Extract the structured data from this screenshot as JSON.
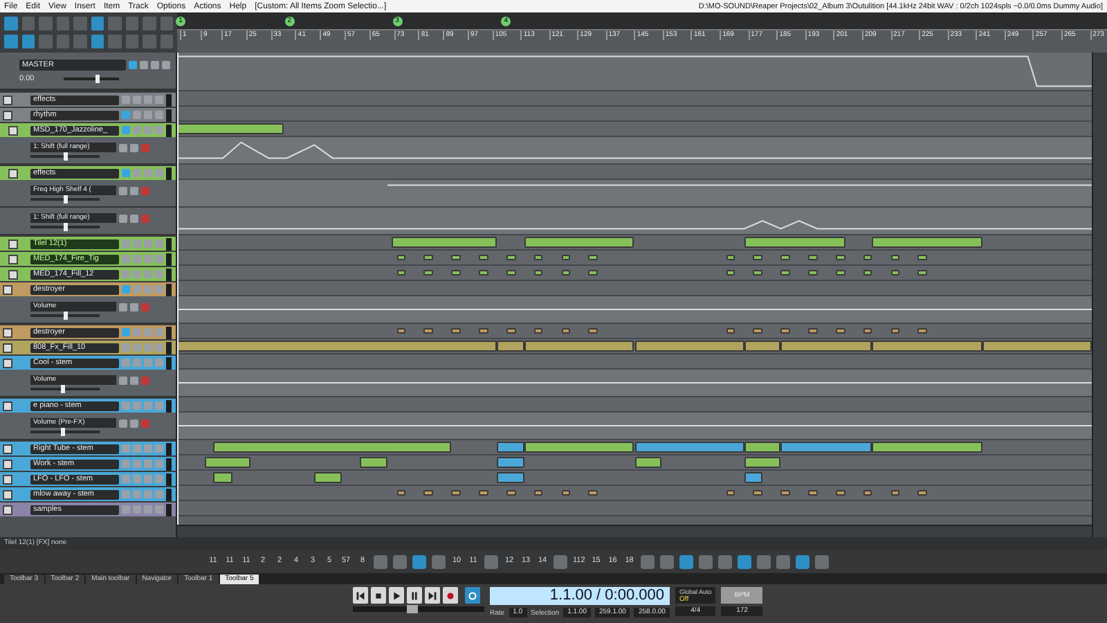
{
  "menu": [
    "File",
    "Edit",
    "View",
    "Insert",
    "Item",
    "Track",
    "Options",
    "Actions",
    "Help"
  ],
  "toolbar_caption": "[Custom: All Items Zoom Selectio...]",
  "window": {
    "title": "D:\\MO-SOUND\\Reaper Projects\\02_Album 3\\Outulition [44.1kHz 24bit WAV : 0/2ch 1024spls ~0.0/0.0ms Dummy Audio]"
  },
  "markers": [
    "1",
    "2",
    "3",
    "4"
  ],
  "ruler": [
    "1",
    "9",
    "17",
    "25",
    "33",
    "41",
    "49",
    "57",
    "65",
    "73",
    "81",
    "89",
    "97",
    "105",
    "113",
    "121",
    "129",
    "137",
    "145",
    "153",
    "161",
    "169",
    "177",
    "185",
    "193",
    "201",
    "209",
    "217",
    "225",
    "233",
    "241",
    "249",
    "257",
    "265",
    "273"
  ],
  "master": {
    "name": "MASTER",
    "volume": "0.00",
    "fx": true,
    "level": 0.6
  },
  "tracks": [
    {
      "name": "effects",
      "color": "#7d8287",
      "fx": false,
      "selected": false
    },
    {
      "name": "rhythm",
      "color": "#7d8287",
      "fx": true,
      "selected": false,
      "children": [
        {
          "name": "MSD_170_Jazzoline_",
          "color": "#86c05a",
          "fx": true,
          "selected": false,
          "envelopes": [
            {
              "name": "1: Shift (full range)",
              "level": 0.5
            }
          ]
        },
        {
          "name": "effects",
          "color": "#86c05a",
          "fx": true,
          "selected": false,
          "envelopes": [
            {
              "name": "Freq High Shelf 4 (",
              "level": 0.5
            },
            {
              "name": "1: Shift (full range)",
              "level": 0.5
            }
          ]
        },
        {
          "name": "Tilel 12(1)",
          "color": "#86c05a",
          "fx": false,
          "selected": true
        },
        {
          "name": "MED_174_Fire_Tig",
          "color": "#86c05a",
          "fx": false,
          "selected": true
        },
        {
          "name": "MED_174_Fill_12",
          "color": "#86c05a",
          "fx": false,
          "selected": false
        }
      ]
    },
    {
      "name": "destroyer",
      "color": "#c09a60",
      "fx": true,
      "selected": false,
      "envelopes": [
        {
          "name": "Volume",
          "level": 0.5
        }
      ]
    },
    {
      "name": "destroyer",
      "color": "#c09a60",
      "fx": true,
      "selected": false
    },
    {
      "name": "808_Fx_Fill_10",
      "color": "#b0a45e",
      "fx": false,
      "selected": false
    },
    {
      "name": "Cool - stem",
      "color": "#4aa8d8",
      "fx": false,
      "selected": false,
      "envelopes": [
        {
          "name": "Volume",
          "level": 0.45
        }
      ]
    },
    {
      "name": "e piano - stem",
      "color": "#4aa8d8",
      "fx": false,
      "selected": false,
      "envelopes": [
        {
          "name": "Volume (Pre-FX)",
          "level": 0.45
        }
      ]
    },
    {
      "name": "Right Tube - stem",
      "color": "#4aa8d8",
      "fx": false,
      "selected": false
    },
    {
      "name": "Work - stem",
      "color": "#4aa8d8",
      "fx": false,
      "selected": false
    },
    {
      "name": "LFO - LFO - stem",
      "color": "#4aa8d8",
      "fx": false,
      "selected": false
    },
    {
      "name": "mlow away - stem",
      "color": "#4aa8d8",
      "fx": false,
      "selected": false
    },
    {
      "name": "samples",
      "color": "#8c84a8",
      "fx": false,
      "selected": false
    }
  ],
  "status_bar": "Tilel 12(1) [FX] none",
  "bottom_toolbar": [
    {
      "kind": "text",
      "label": "11"
    },
    {
      "kind": "text",
      "label": "11"
    },
    {
      "kind": "text",
      "label": "11"
    },
    {
      "kind": "text",
      "label": "2"
    },
    {
      "kind": "text",
      "label": "2"
    },
    {
      "kind": "text",
      "label": "4"
    },
    {
      "kind": "text",
      "label": "3"
    },
    {
      "kind": "text",
      "label": "5"
    },
    {
      "kind": "text",
      "label": "57"
    },
    {
      "kind": "text",
      "label": "8"
    },
    {
      "kind": "icon"
    },
    {
      "kind": "icon"
    },
    {
      "kind": "icon"
    },
    {
      "kind": "icon"
    },
    {
      "kind": "text",
      "label": "10"
    },
    {
      "kind": "text",
      "label": "11"
    },
    {
      "kind": "icon"
    },
    {
      "kind": "text",
      "label": "12"
    },
    {
      "kind": "text",
      "label": "13"
    },
    {
      "kind": "text",
      "label": "14"
    },
    {
      "kind": "icon"
    },
    {
      "kind": "text",
      "label": "112"
    },
    {
      "kind": "text",
      "label": "15"
    },
    {
      "kind": "text",
      "label": "16"
    },
    {
      "kind": "text",
      "label": "18"
    },
    {
      "kind": "icon"
    },
    {
      "kind": "icon"
    },
    {
      "kind": "icon"
    },
    {
      "kind": "icon"
    },
    {
      "kind": "icon"
    },
    {
      "kind": "icon"
    },
    {
      "kind": "icon"
    },
    {
      "kind": "icon"
    },
    {
      "kind": "icon"
    },
    {
      "kind": "icon"
    }
  ],
  "toolbar_tabs": [
    {
      "label": "Toolbar 3",
      "selected": false
    },
    {
      "label": "Toolbar 2",
      "selected": false
    },
    {
      "label": "Main toolbar",
      "selected": false
    },
    {
      "label": "Navigator",
      "selected": false
    },
    {
      "label": "Toolbar 1",
      "selected": false
    },
    {
      "label": "Toolbar 5",
      "selected": true
    }
  ],
  "transport": {
    "repeat_on": true,
    "playrate": {
      "level": 0.45
    },
    "time": "1.1.00 / 0:00.000",
    "rate_label": "Rate",
    "rate": "1.0",
    "selection_label": "Selection",
    "selection_start": "1.1.00",
    "selection_end": "259.1.00",
    "selection_length": "258.0.00",
    "global_auto_label": "Global Auto",
    "global_auto": "Off",
    "bpm_button": "BPM",
    "time_signature": "4/4",
    "tempo": "172"
  }
}
